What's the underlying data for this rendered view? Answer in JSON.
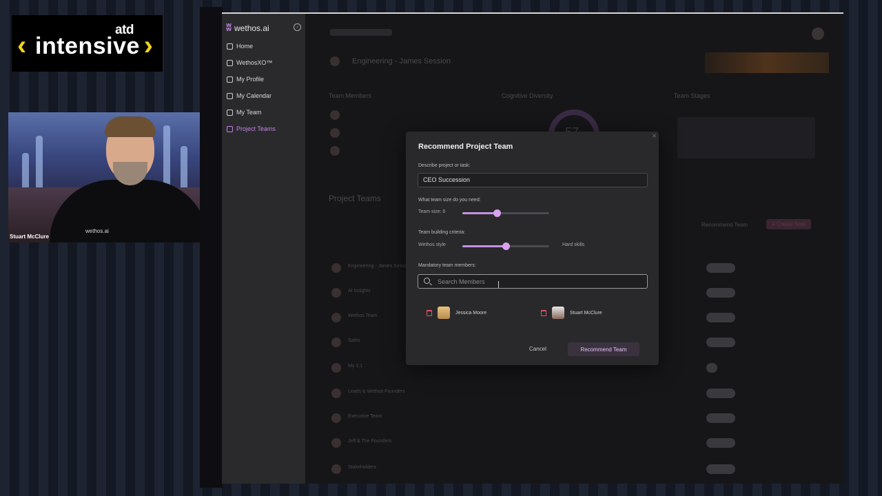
{
  "overlay": {
    "logo_small": "atd",
    "logo_word": "intensive",
    "speaker_name": "Stuart McClure",
    "shirt_logo": "wethos.ai"
  },
  "app": {
    "brand": "wethos.ai",
    "nav": [
      {
        "label": "Home",
        "icon": "home-icon",
        "active": false
      },
      {
        "label": "WethosXO™",
        "icon": "network-icon",
        "active": false
      },
      {
        "label": "My Profile",
        "icon": "user-icon",
        "active": false
      },
      {
        "label": "My Calendar",
        "icon": "calendar-icon",
        "active": false
      },
      {
        "label": "My Team",
        "icon": "team-icon",
        "active": false
      },
      {
        "label": "Project Teams",
        "icon": "project-teams-icon",
        "active": true
      }
    ],
    "background": {
      "page_title": "Engineering - James Session",
      "team_members": "Team Members",
      "cognitive_diversity": "Cognitive Diversity",
      "team_stage": "Team Stages",
      "score": "57",
      "project_teams": "Project Teams",
      "recommend_team": "Recommend Team",
      "create_new": "+ Create New",
      "rows": [
        "Engineering - James Session",
        "AI Insights",
        "Wethos Team",
        "Sales",
        "My 1:1",
        "Leads & Wethos Founders",
        "Executive Team",
        "Jeff & The Founders",
        "Stakeholders"
      ]
    }
  },
  "modal": {
    "title": "Recommend Project Team",
    "describe_label": "Describe project or task:",
    "task_value": "CEO Succession",
    "size_label": "What team size do you need:",
    "size_text": "Team size: 6",
    "size_value": 0.4,
    "criteria_label": "Team building criteria:",
    "criteria_left": "Wethos style",
    "criteria_right": "Hard skills",
    "criteria_value": 0.5,
    "mandatory_label": "Mandatory team members:",
    "search_placeholder": "Search Members",
    "members": [
      "Jessica Moore",
      "Stuart McClure"
    ],
    "cancel": "Cancel",
    "submit": "Recommend Team"
  }
}
